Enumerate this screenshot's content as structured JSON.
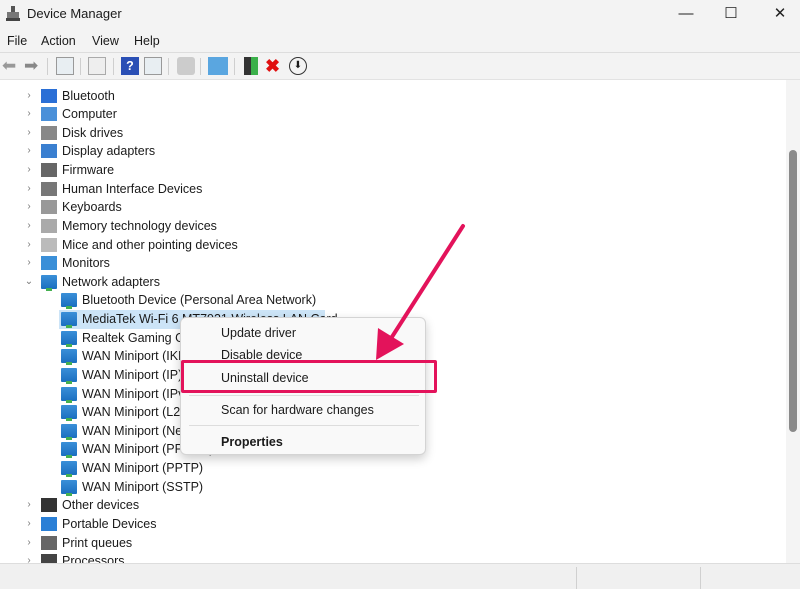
{
  "window": {
    "title": "Device Manager",
    "minimize": "—",
    "maximize": "☐",
    "close": "✕"
  },
  "menu": [
    "File",
    "Action",
    "View",
    "Help"
  ],
  "toolbar": [
    "back-icon",
    "forward-icon",
    "show-hide-console-tree-icon",
    "properties-icon",
    "help-icon",
    "show-action-pane-icon",
    "update-driver-icon",
    "scan-hardware-icon",
    "enable-device-icon",
    "uninstall-icon",
    "disable-device-icon"
  ],
  "tree": {
    "categories_top": [
      "Bluetooth",
      "Computer",
      "Disk drives",
      "Display adapters",
      "Firmware",
      "Human Interface Devices",
      "Keyboards",
      "Memory technology devices",
      "Mice and other pointing devices",
      "Monitors",
      "Network adapters"
    ],
    "network_children": [
      "Bluetooth Device (Personal Area Network)",
      "MediaTek Wi-Fi 6 MT7921 Wireless LAN Card",
      "Realtek Gaming GbE Family Controller",
      "WAN Miniport (IKEv2)",
      "WAN Miniport (IP)",
      "WAN Miniport (IPv6)",
      "WAN Miniport (L2TP)",
      "WAN Miniport (Network Monitor)",
      "WAN Miniport (PPPOE)",
      "WAN Miniport (PPTP)",
      "WAN Miniport (SSTP)"
    ],
    "categories_bottom": [
      "Other devices",
      "Portable Devices",
      "Print queues",
      "Processors"
    ]
  },
  "context_menu": {
    "update": "Update driver",
    "disable": "Disable device",
    "uninstall": "Uninstall device",
    "scan": "Scan for hardware changes",
    "properties": "Properties"
  },
  "colors": {
    "highlight": "#e3135b",
    "selection": "#cce4f7"
  }
}
